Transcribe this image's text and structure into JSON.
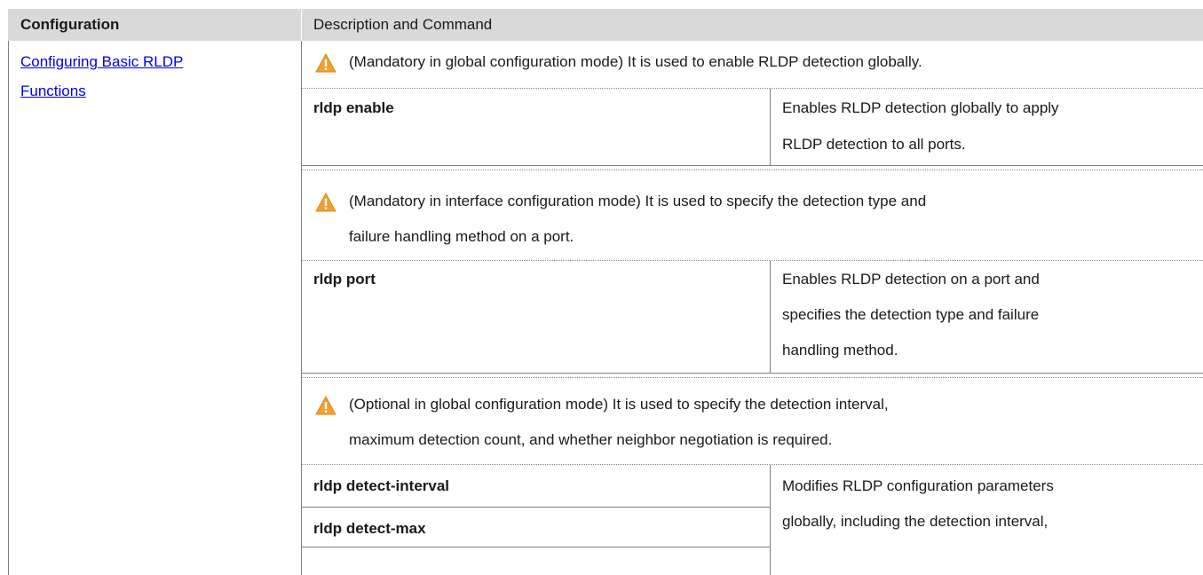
{
  "header": {
    "configuration": "Configuration",
    "description": "Description and Command"
  },
  "row": {
    "link_line1": "Configuring Basic RLDP ",
    "link_line2": "Functions",
    "note1": "(Mandatory in global configuration mode) It is used to enable RLDP detection globally.",
    "cmd1": "rldp enable",
    "desc1_line1": "Enables RLDP detection globally to apply",
    "desc1_line2": "RLDP detection to all ports.",
    "note2_line1": "(Mandatory in interface configuration mode) It is used to specify the detection type and",
    "note2_line2": "failure handling method on a port.",
    "cmd2": "rldp port",
    "desc2_line1": "Enables RLDP detection on a port and",
    "desc2_line2": "specifies the detection type and failure",
    "desc2_line3": "handling method.",
    "note3_line1": "(Optional in global configuration mode) It is used to specify the detection interval,",
    "note3_line2": "maximum detection count, and whether neighbor negotiation is required.",
    "cmd3a": "rldp detect-interval",
    "cmd3b": "rldp detect-max",
    "desc3_line1": "Modifies RLDP configuration parameters",
    "desc3_line2": "globally, including the detection interval,"
  },
  "colors": {
    "header_bg": "#d9d9d9",
    "link": "#0000ee",
    "warning_fill": "#f0a030",
    "border": "#7f7f7f"
  },
  "icons": [
    "warning-icon"
  ]
}
